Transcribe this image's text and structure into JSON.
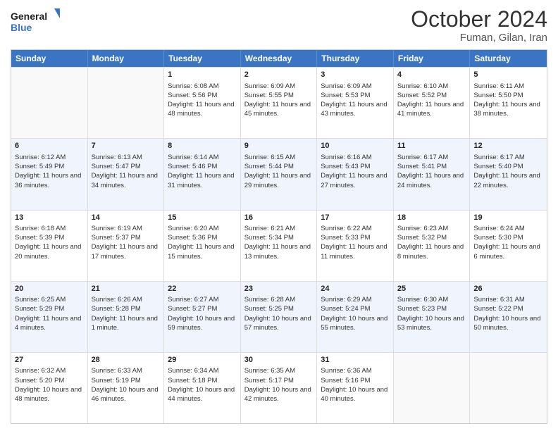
{
  "logo": {
    "line1": "General",
    "line2": "Blue"
  },
  "title": "October 2024",
  "location": "Fuman, Gilan, Iran",
  "header_days": [
    "Sunday",
    "Monday",
    "Tuesday",
    "Wednesday",
    "Thursday",
    "Friday",
    "Saturday"
  ],
  "weeks": [
    [
      {
        "day": "",
        "sunrise": "",
        "sunset": "",
        "daylight": "",
        "empty": true
      },
      {
        "day": "",
        "sunrise": "",
        "sunset": "",
        "daylight": "",
        "empty": true
      },
      {
        "day": "1",
        "sunrise": "Sunrise: 6:08 AM",
        "sunset": "Sunset: 5:56 PM",
        "daylight": "Daylight: 11 hours and 48 minutes."
      },
      {
        "day": "2",
        "sunrise": "Sunrise: 6:09 AM",
        "sunset": "Sunset: 5:55 PM",
        "daylight": "Daylight: 11 hours and 45 minutes."
      },
      {
        "day": "3",
        "sunrise": "Sunrise: 6:09 AM",
        "sunset": "Sunset: 5:53 PM",
        "daylight": "Daylight: 11 hours and 43 minutes."
      },
      {
        "day": "4",
        "sunrise": "Sunrise: 6:10 AM",
        "sunset": "Sunset: 5:52 PM",
        "daylight": "Daylight: 11 hours and 41 minutes."
      },
      {
        "day": "5",
        "sunrise": "Sunrise: 6:11 AM",
        "sunset": "Sunset: 5:50 PM",
        "daylight": "Daylight: 11 hours and 38 minutes."
      }
    ],
    [
      {
        "day": "6",
        "sunrise": "Sunrise: 6:12 AM",
        "sunset": "Sunset: 5:49 PM",
        "daylight": "Daylight: 11 hours and 36 minutes."
      },
      {
        "day": "7",
        "sunrise": "Sunrise: 6:13 AM",
        "sunset": "Sunset: 5:47 PM",
        "daylight": "Daylight: 11 hours and 34 minutes."
      },
      {
        "day": "8",
        "sunrise": "Sunrise: 6:14 AM",
        "sunset": "Sunset: 5:46 PM",
        "daylight": "Daylight: 11 hours and 31 minutes."
      },
      {
        "day": "9",
        "sunrise": "Sunrise: 6:15 AM",
        "sunset": "Sunset: 5:44 PM",
        "daylight": "Daylight: 11 hours and 29 minutes."
      },
      {
        "day": "10",
        "sunrise": "Sunrise: 6:16 AM",
        "sunset": "Sunset: 5:43 PM",
        "daylight": "Daylight: 11 hours and 27 minutes."
      },
      {
        "day": "11",
        "sunrise": "Sunrise: 6:17 AM",
        "sunset": "Sunset: 5:41 PM",
        "daylight": "Daylight: 11 hours and 24 minutes."
      },
      {
        "day": "12",
        "sunrise": "Sunrise: 6:17 AM",
        "sunset": "Sunset: 5:40 PM",
        "daylight": "Daylight: 11 hours and 22 minutes."
      }
    ],
    [
      {
        "day": "13",
        "sunrise": "Sunrise: 6:18 AM",
        "sunset": "Sunset: 5:39 PM",
        "daylight": "Daylight: 11 hours and 20 minutes."
      },
      {
        "day": "14",
        "sunrise": "Sunrise: 6:19 AM",
        "sunset": "Sunset: 5:37 PM",
        "daylight": "Daylight: 11 hours and 17 minutes."
      },
      {
        "day": "15",
        "sunrise": "Sunrise: 6:20 AM",
        "sunset": "Sunset: 5:36 PM",
        "daylight": "Daylight: 11 hours and 15 minutes."
      },
      {
        "day": "16",
        "sunrise": "Sunrise: 6:21 AM",
        "sunset": "Sunset: 5:34 PM",
        "daylight": "Daylight: 11 hours and 13 minutes."
      },
      {
        "day": "17",
        "sunrise": "Sunrise: 6:22 AM",
        "sunset": "Sunset: 5:33 PM",
        "daylight": "Daylight: 11 hours and 11 minutes."
      },
      {
        "day": "18",
        "sunrise": "Sunrise: 6:23 AM",
        "sunset": "Sunset: 5:32 PM",
        "daylight": "Daylight: 11 hours and 8 minutes."
      },
      {
        "day": "19",
        "sunrise": "Sunrise: 6:24 AM",
        "sunset": "Sunset: 5:30 PM",
        "daylight": "Daylight: 11 hours and 6 minutes."
      }
    ],
    [
      {
        "day": "20",
        "sunrise": "Sunrise: 6:25 AM",
        "sunset": "Sunset: 5:29 PM",
        "daylight": "Daylight: 11 hours and 4 minutes."
      },
      {
        "day": "21",
        "sunrise": "Sunrise: 6:26 AM",
        "sunset": "Sunset: 5:28 PM",
        "daylight": "Daylight: 11 hours and 1 minute."
      },
      {
        "day": "22",
        "sunrise": "Sunrise: 6:27 AM",
        "sunset": "Sunset: 5:27 PM",
        "daylight": "Daylight: 10 hours and 59 minutes."
      },
      {
        "day": "23",
        "sunrise": "Sunrise: 6:28 AM",
        "sunset": "Sunset: 5:25 PM",
        "daylight": "Daylight: 10 hours and 57 minutes."
      },
      {
        "day": "24",
        "sunrise": "Sunrise: 6:29 AM",
        "sunset": "Sunset: 5:24 PM",
        "daylight": "Daylight: 10 hours and 55 minutes."
      },
      {
        "day": "25",
        "sunrise": "Sunrise: 6:30 AM",
        "sunset": "Sunset: 5:23 PM",
        "daylight": "Daylight: 10 hours and 53 minutes."
      },
      {
        "day": "26",
        "sunrise": "Sunrise: 6:31 AM",
        "sunset": "Sunset: 5:22 PM",
        "daylight": "Daylight: 10 hours and 50 minutes."
      }
    ],
    [
      {
        "day": "27",
        "sunrise": "Sunrise: 6:32 AM",
        "sunset": "Sunset: 5:20 PM",
        "daylight": "Daylight: 10 hours and 48 minutes."
      },
      {
        "day": "28",
        "sunrise": "Sunrise: 6:33 AM",
        "sunset": "Sunset: 5:19 PM",
        "daylight": "Daylight: 10 hours and 46 minutes."
      },
      {
        "day": "29",
        "sunrise": "Sunrise: 6:34 AM",
        "sunset": "Sunset: 5:18 PM",
        "daylight": "Daylight: 10 hours and 44 minutes."
      },
      {
        "day": "30",
        "sunrise": "Sunrise: 6:35 AM",
        "sunset": "Sunset: 5:17 PM",
        "daylight": "Daylight: 10 hours and 42 minutes."
      },
      {
        "day": "31",
        "sunrise": "Sunrise: 6:36 AM",
        "sunset": "Sunset: 5:16 PM",
        "daylight": "Daylight: 10 hours and 40 minutes."
      },
      {
        "day": "",
        "sunrise": "",
        "sunset": "",
        "daylight": "",
        "empty": true
      },
      {
        "day": "",
        "sunrise": "",
        "sunset": "",
        "daylight": "",
        "empty": true
      }
    ]
  ]
}
